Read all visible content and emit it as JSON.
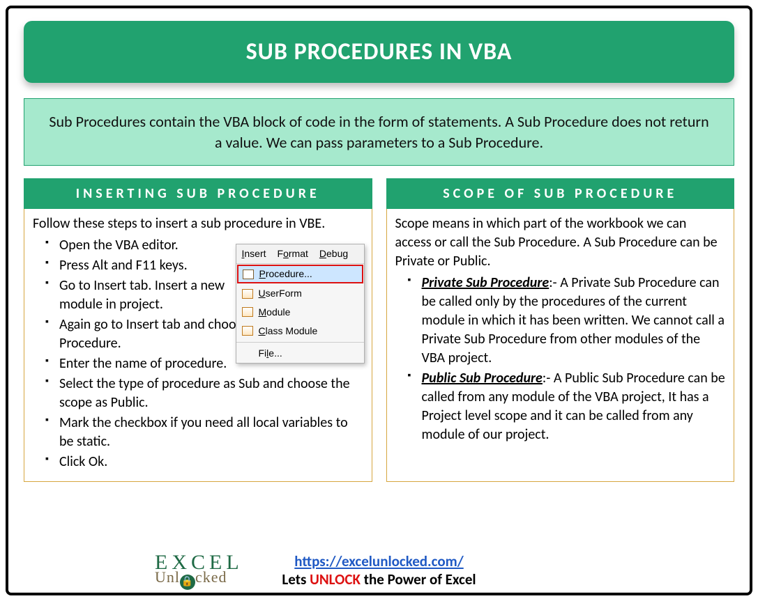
{
  "title": "SUB PROCEDURES IN VBA",
  "intro": "Sub Procedures contain the VBA block of code in the form of statements. A Sub Procedure does not return a value. We can pass parameters to a Sub Procedure.",
  "left": {
    "header": "INSERTING SUB PROCEDURE",
    "lead": "Follow these steps to insert a sub procedure in VBE.",
    "steps": [
      "Open the VBA editor.",
      " Press Alt and F11 keys.",
      "Go to Insert tab. Insert a new module in project.",
      "Again go to Insert tab and choose Procedure.",
      "Enter the name of procedure.",
      "Select the type of procedure as Sub and choose the scope as Public.",
      "Mark the checkbox if you need all local variables to be static.",
      "Click Ok."
    ],
    "menu": {
      "bar": [
        "Insert",
        "Format",
        "Debug"
      ],
      "items": [
        "Procedure...",
        "UserForm",
        "Module",
        "Class Module",
        "File..."
      ]
    }
  },
  "right": {
    "header": "SCOPE OF SUB PROCEDURE",
    "lead": "Scope means in which part of the workbook we can access or call the Sub Procedure. A Sub Procedure can be Private or Public.",
    "private_label": "Private Sub Procedure",
    "private_text": ":- A Private Sub Procedure can be called only by the procedures of the current module in which it has been written. We cannot call a Private Sub Procedure from other modules of the VBA project.",
    "public_label": "Public Sub Procedure",
    "public_text": ":- A Public Sub Procedure can be called from any module of the VBA project, It has a Project level scope and it can be called from any module of our project."
  },
  "footer": {
    "url": "https://excelunlocked.com/",
    "tag_pre": "Lets ",
    "tag_em": "UNLOCK",
    "tag_post": " the Power of Excel"
  },
  "logo": {
    "top": "EXCEL",
    "bot_pre": "Unl",
    "bot_post": "cked"
  }
}
